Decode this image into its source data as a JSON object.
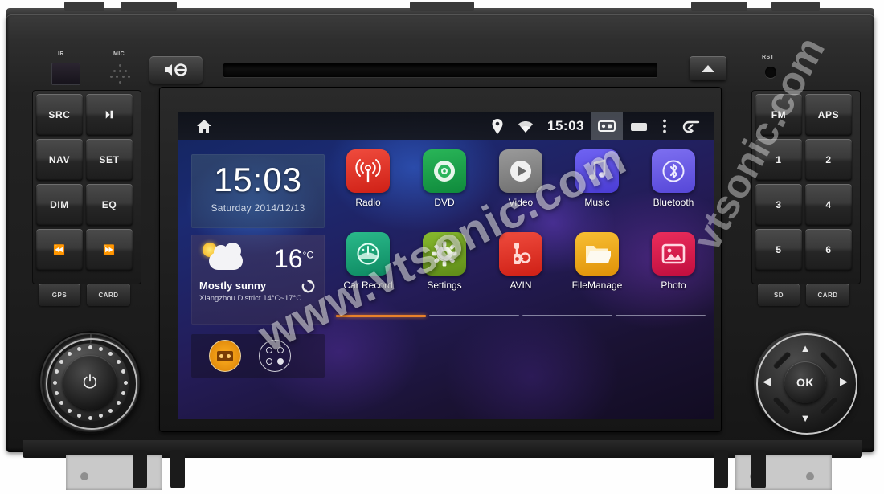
{
  "device": {
    "top_panel": {
      "ir_label": "IR",
      "mic_label": "MIC",
      "mute_button": "mute-icon",
      "cd_slot": "disc-slot",
      "eject_button": "eject-icon",
      "reset_label": "RST"
    },
    "left_buttons": [
      {
        "label": "SRC",
        "name": "source-button"
      },
      {
        "label": "⏵❙",
        "name": "play-pause-button"
      },
      {
        "label": "NAV",
        "name": "navigation-button"
      },
      {
        "label": "SET",
        "name": "setup-button"
      },
      {
        "label": "DIM",
        "name": "dimmer-button"
      },
      {
        "label": "EQ",
        "name": "equalizer-button"
      },
      {
        "label": "⏪",
        "name": "previous-track-button"
      },
      {
        "label": "⏩",
        "name": "next-track-button"
      }
    ],
    "left_slots": [
      {
        "label": "GPS",
        "name": "gps-card-slot"
      },
      {
        "label": "CARD",
        "name": "card-slot"
      }
    ],
    "right_buttons": [
      {
        "label": "FM",
        "name": "fm-band-button"
      },
      {
        "label": "APS",
        "name": "auto-preset-scan-button"
      },
      {
        "label": "1",
        "name": "preset-1-button"
      },
      {
        "label": "2",
        "name": "preset-2-button"
      },
      {
        "label": "3",
        "name": "preset-3-button"
      },
      {
        "label": "4",
        "name": "preset-4-button"
      },
      {
        "label": "5",
        "name": "preset-5-button"
      },
      {
        "label": "6",
        "name": "preset-6-button"
      }
    ],
    "right_slots": [
      {
        "label": "SD",
        "name": "sd-slot"
      },
      {
        "label": "CARD",
        "name": "card-slot-right"
      }
    ],
    "volume_knob": {
      "icon": "power-icon"
    },
    "dpad": {
      "center_label": "OK",
      "up": "▲",
      "down": "▼",
      "left": "◀",
      "right": "▶"
    }
  },
  "screen": {
    "statusbar": {
      "home_icon": "home-icon",
      "location_icon": "location-pin-icon",
      "wifi_icon": "wifi-icon",
      "clock": "15:03",
      "screenshot_icon": "screenshot-icon",
      "recents_icon": "recents-icon",
      "overflow_icon": "overflow-menu-icon",
      "back_icon": "back-arrow-icon"
    },
    "clock_widget": {
      "time": "15:03",
      "date": "Saturday 2014/12/13"
    },
    "weather_widget": {
      "temperature": "16",
      "unit": "°C",
      "condition": "Mostly sunny",
      "location_range": "Xiangzhou District 14°C~17°C",
      "refresh_icon": "refresh-icon",
      "weather_icon": "sun-behind-cloud-icon"
    },
    "dock": [
      {
        "name": "media-shortcut",
        "icon": "cassette-icon",
        "color": "#ffb021"
      },
      {
        "name": "all-apps-shortcut",
        "icon": "apps-grid-icon",
        "color": "#e2e2ea"
      }
    ],
    "apps": [
      [
        {
          "label": "Radio",
          "icon": "radio-antenna-icon",
          "color": "#e0342b"
        },
        {
          "label": "DVD",
          "icon": "disc-icon",
          "color": "#1a9e4b"
        },
        {
          "label": "Video",
          "icon": "play-circle-icon",
          "color": "#8c8c8c"
        },
        {
          "label": "Music",
          "icon": "music-note-icon",
          "color": "#5a4ee0"
        },
        {
          "label": "Bluetooth",
          "icon": "bluetooth-icon",
          "color": "#6c5ce8"
        }
      ],
      [
        {
          "label": "Car Record",
          "icon": "dashcam-icon",
          "color": "#18a172"
        },
        {
          "label": "Settings",
          "icon": "gear-icon",
          "color": "#74a324"
        },
        {
          "label": "AVIN",
          "icon": "av-input-icon",
          "color": "#e0342b"
        },
        {
          "label": "FileManage",
          "icon": "folder-icon",
          "color": "#f0a81b"
        },
        {
          "label": "Photo",
          "icon": "photo-icon",
          "color": "#d9224f"
        }
      ]
    ],
    "pages": {
      "count": 4,
      "active": 1
    }
  },
  "watermark": {
    "text": "www.vtsonic.com",
    "text2": "vtsonic.com"
  }
}
